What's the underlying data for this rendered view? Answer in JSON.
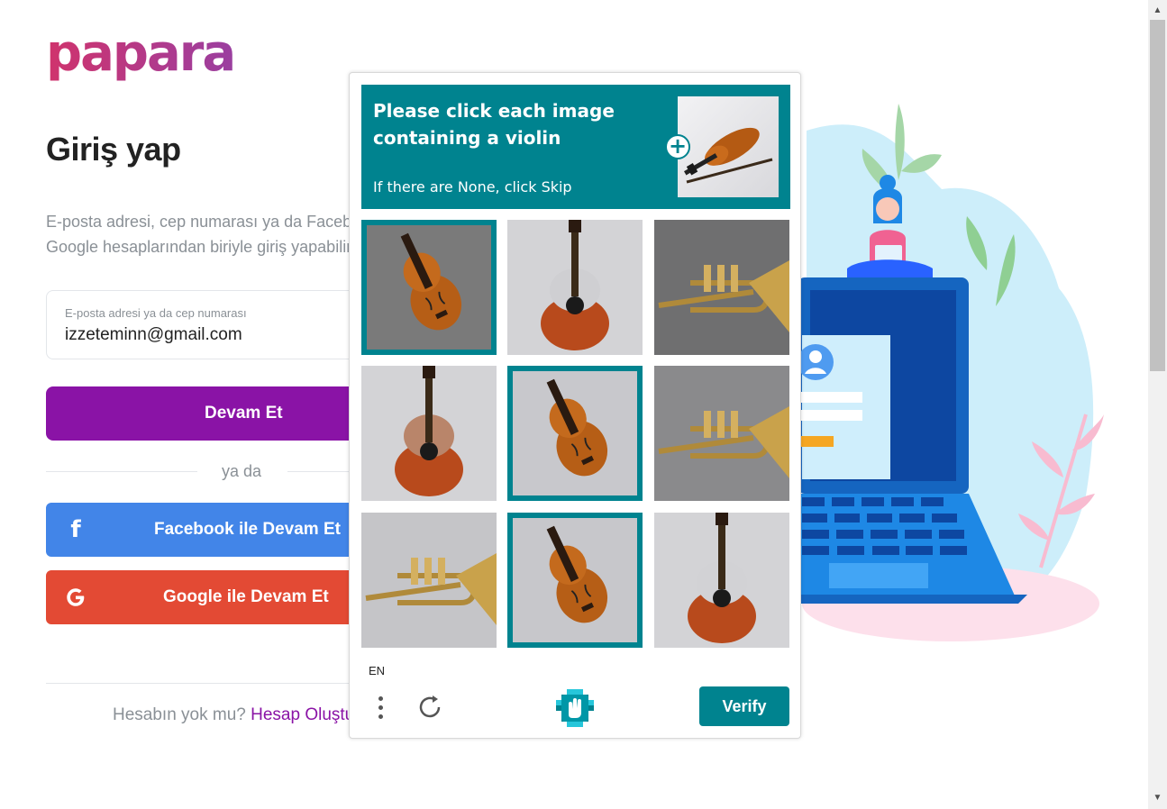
{
  "brand": {
    "logo_text": "papara"
  },
  "login": {
    "title": "Giriş yap",
    "subtitle_line1": "E-posta adresi, cep numarası ya da Facebook,",
    "subtitle_line2": "Google hesaplarından biriyle giriş yapabilirsin.",
    "email_label": "E-posta adresi ya da cep numarası",
    "email_value": "izzeteminn@gmail.com",
    "continue_label": "Devam Et",
    "or_label": "ya da",
    "facebook_label": "Facebook ile Devam Et",
    "google_label": "Google ile Devam Et",
    "footer_text": "Hesabın yok mu?",
    "footer_link": "Hesap Oluştur"
  },
  "captcha": {
    "prompt": "Please click each image containing a violin",
    "hint": "If there are None, click Skip",
    "language": "EN",
    "verify_label": "Verify",
    "tiles": [
      {
        "content": "violin",
        "selected": true
      },
      {
        "content": "guitar",
        "selected": false
      },
      {
        "content": "trumpet",
        "selected": false
      },
      {
        "content": "guitar",
        "selected": false
      },
      {
        "content": "violin",
        "selected": true
      },
      {
        "content": "trumpet",
        "selected": false
      },
      {
        "content": "trumpet",
        "selected": false
      },
      {
        "content": "violin",
        "selected": true
      },
      {
        "content": "guitar",
        "selected": false
      }
    ]
  },
  "colors": {
    "brand_purple": "#8a13a6",
    "facebook_blue": "#4285e8",
    "google_red": "#e34a34",
    "captcha_teal": "#00838f"
  }
}
